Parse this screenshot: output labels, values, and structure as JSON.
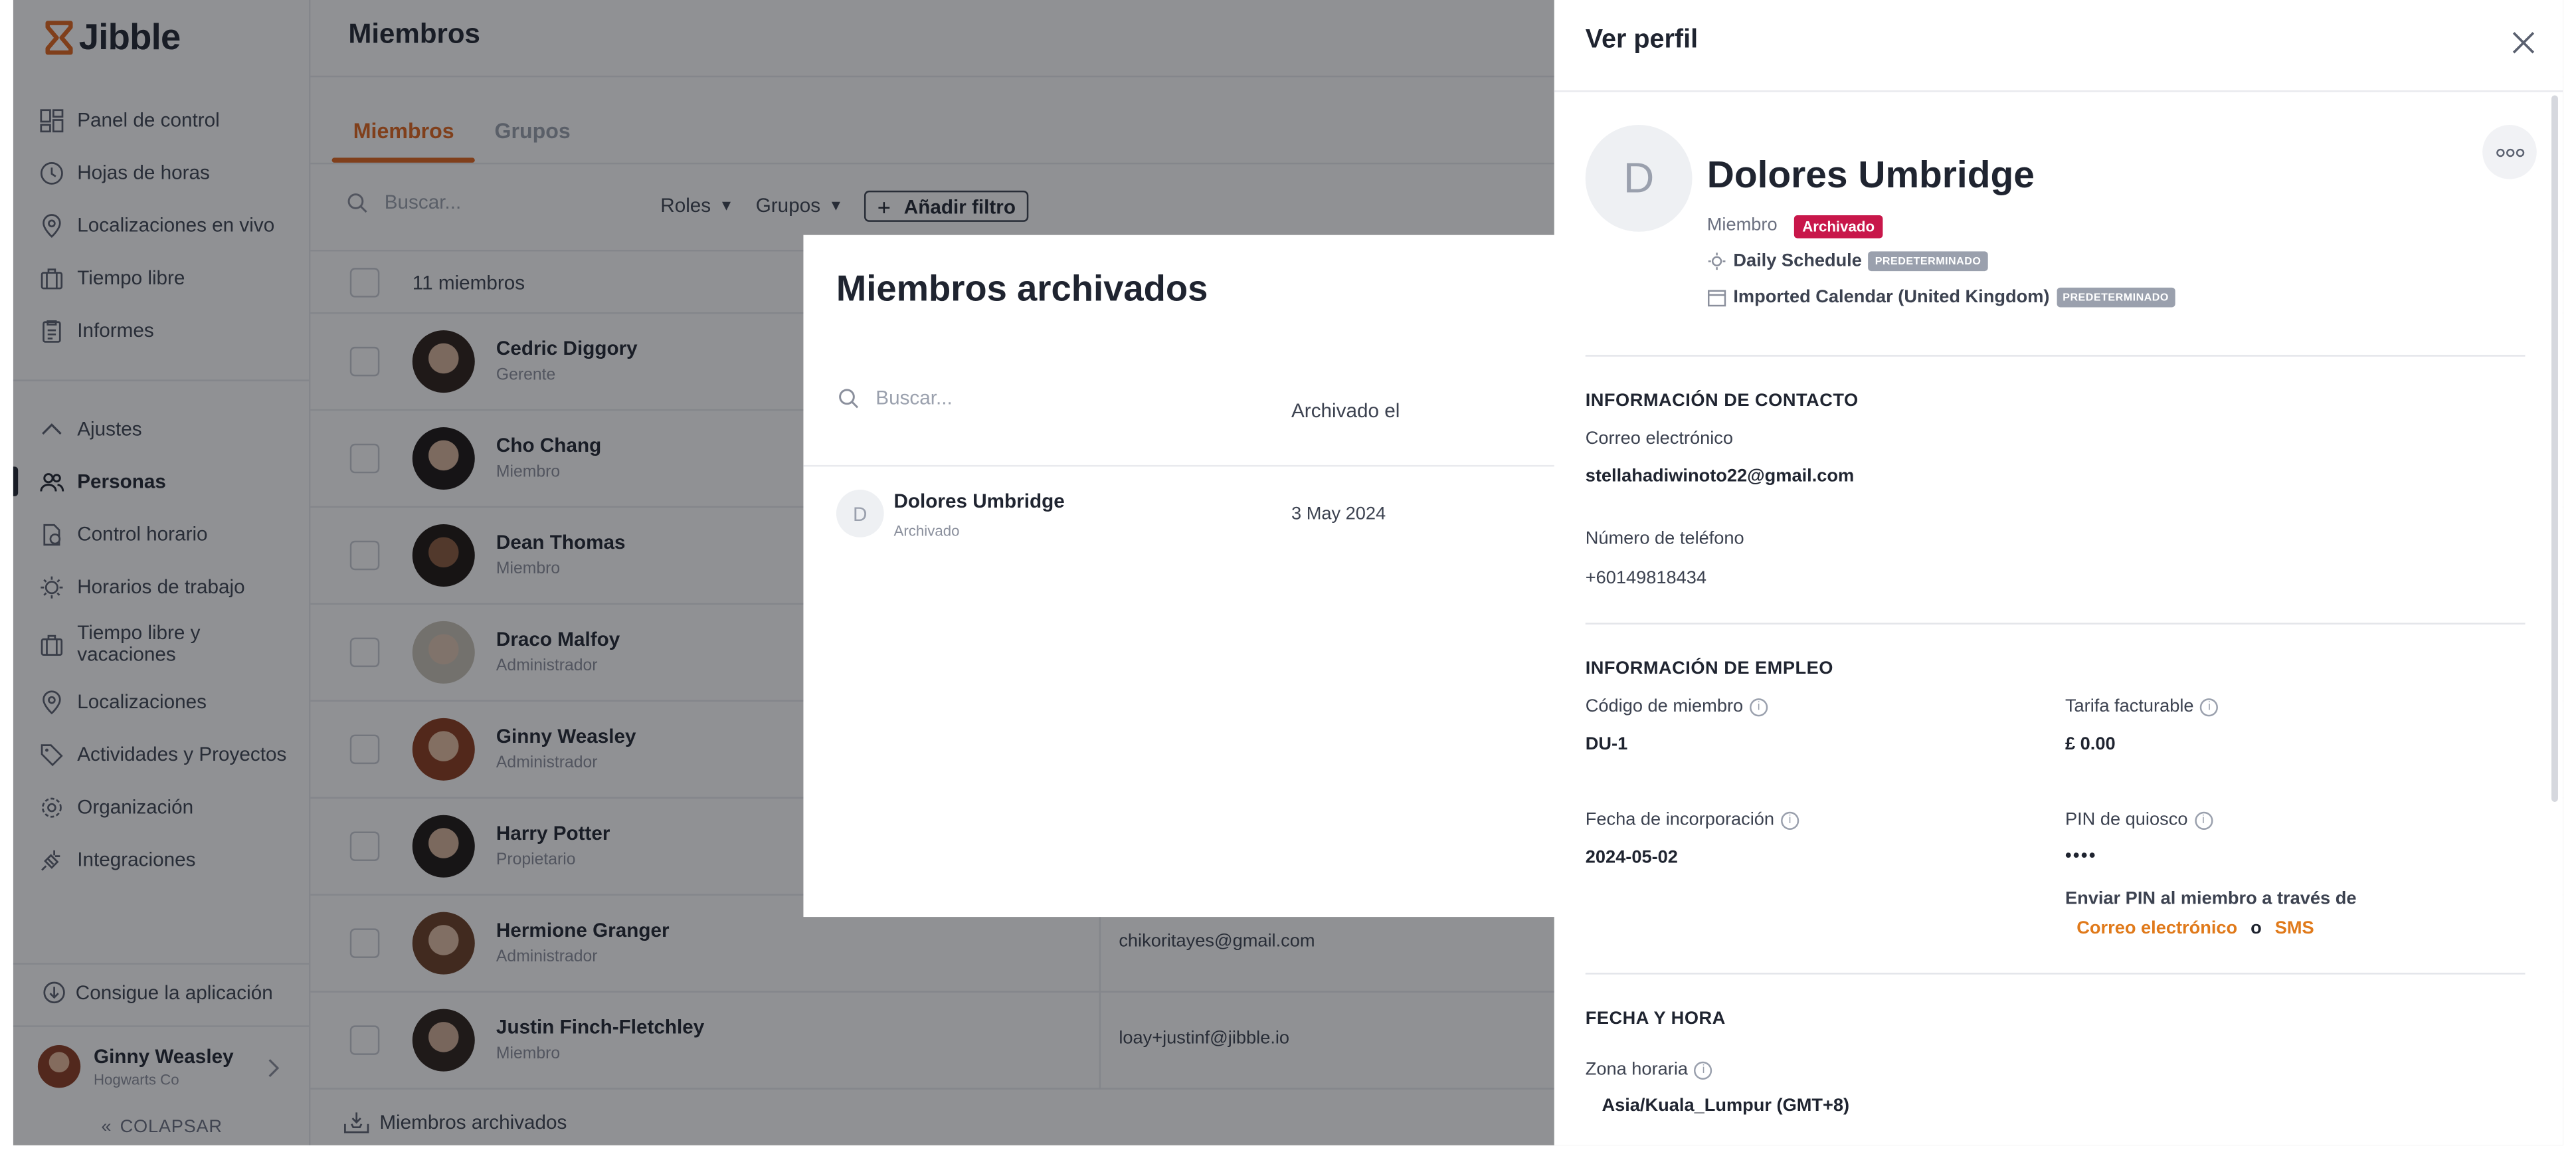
{
  "app": {
    "name": "Jibble"
  },
  "sidebar": {
    "items": [
      {
        "label": "Panel de control"
      },
      {
        "label": "Hojas de horas"
      },
      {
        "label": "Localizaciones en vivo"
      },
      {
        "label": "Tiempo libre"
      },
      {
        "label": "Informes"
      },
      {
        "label": "Ajustes"
      },
      {
        "label": "Personas"
      },
      {
        "label": "Control horario"
      },
      {
        "label": "Horarios de trabajo"
      },
      {
        "label": "Tiempo libre y vacaciones"
      },
      {
        "label": "Localizaciones"
      },
      {
        "label": "Actividades y Proyectos"
      },
      {
        "label": "Organización"
      },
      {
        "label": "Integraciones"
      }
    ],
    "get_app": "Consigue la aplicación",
    "user": {
      "name": "Ginny Weasley",
      "org": "Hogwarts Co"
    },
    "collapse": "COLAPSAR"
  },
  "main": {
    "title": "Miembros",
    "tabs": [
      {
        "label": "Miembros"
      },
      {
        "label": "Grupos"
      }
    ],
    "search_placeholder": "Buscar...",
    "filters": [
      {
        "label": "Roles"
      },
      {
        "label": "Grupos"
      }
    ],
    "add_filter": "Añadir filtro",
    "count": "11 miembros",
    "members": [
      {
        "name": "Cedric Diggory",
        "role": "Gerente",
        "email": ""
      },
      {
        "name": "Cho Chang",
        "role": "Miembro",
        "email": ""
      },
      {
        "name": "Dean Thomas",
        "role": "Miembro",
        "email": ""
      },
      {
        "name": "Draco Malfoy",
        "role": "Administrador",
        "email": ""
      },
      {
        "name": "Ginny Weasley",
        "role": "Administrador",
        "email": ""
      },
      {
        "name": "Harry Potter",
        "role": "Propietario",
        "email": ""
      },
      {
        "name": "Hermione Granger",
        "role": "Administrador",
        "email": "chikoritayes@gmail.com"
      },
      {
        "name": "Justin Finch-Fletchley",
        "role": "Miembro",
        "email": "loay+justinf@jibble.io"
      }
    ],
    "archived_link": "Miembros archivados"
  },
  "modal": {
    "title": "Miembros archivados",
    "search_placeholder": "Buscar...",
    "col_archived": "Archivado el",
    "row": {
      "initial": "D",
      "name": "Dolores Umbridge",
      "status": "Archivado",
      "date": "3 May 2024"
    }
  },
  "profile": {
    "header": "Ver perfil",
    "initial": "D",
    "name": "Dolores Umbridge",
    "role": "Miembro",
    "status_badge": "Archivado",
    "schedule": "Daily Schedule",
    "calendar": "Imported Calendar (United Kingdom)",
    "default_badge": "PREDETERMINADO",
    "contact": {
      "heading": "INFORMACIÓN DE CONTACTO",
      "email_label": "Correo electrónico",
      "email": "stellahadiwinoto22@gmail.com",
      "phone_label": "Número de teléfono",
      "phone": "+60149818434"
    },
    "employment": {
      "heading": "INFORMACIÓN DE EMPLEO",
      "code_label": "Código de miembro",
      "code": "DU-1",
      "rate_label": "Tarifa facturable",
      "rate": "£ 0.00",
      "join_label": "Fecha de incorporación",
      "join": "2024-05-02",
      "pin_label": "PIN de quiosco",
      "pin": "••••",
      "pin_send": "Enviar PIN al miembro a través de",
      "pin_email": "Correo electrónico",
      "pin_or": "o",
      "pin_sms": "SMS"
    },
    "datetime": {
      "heading": "FECHA Y HORA",
      "tz_label": "Zona horaria",
      "tz": "Asia/Kuala_Lumpur (GMT+8)"
    }
  },
  "colors": {
    "accent": "#e0651b",
    "archived": "#c8174a",
    "link": "#e07a1b"
  }
}
